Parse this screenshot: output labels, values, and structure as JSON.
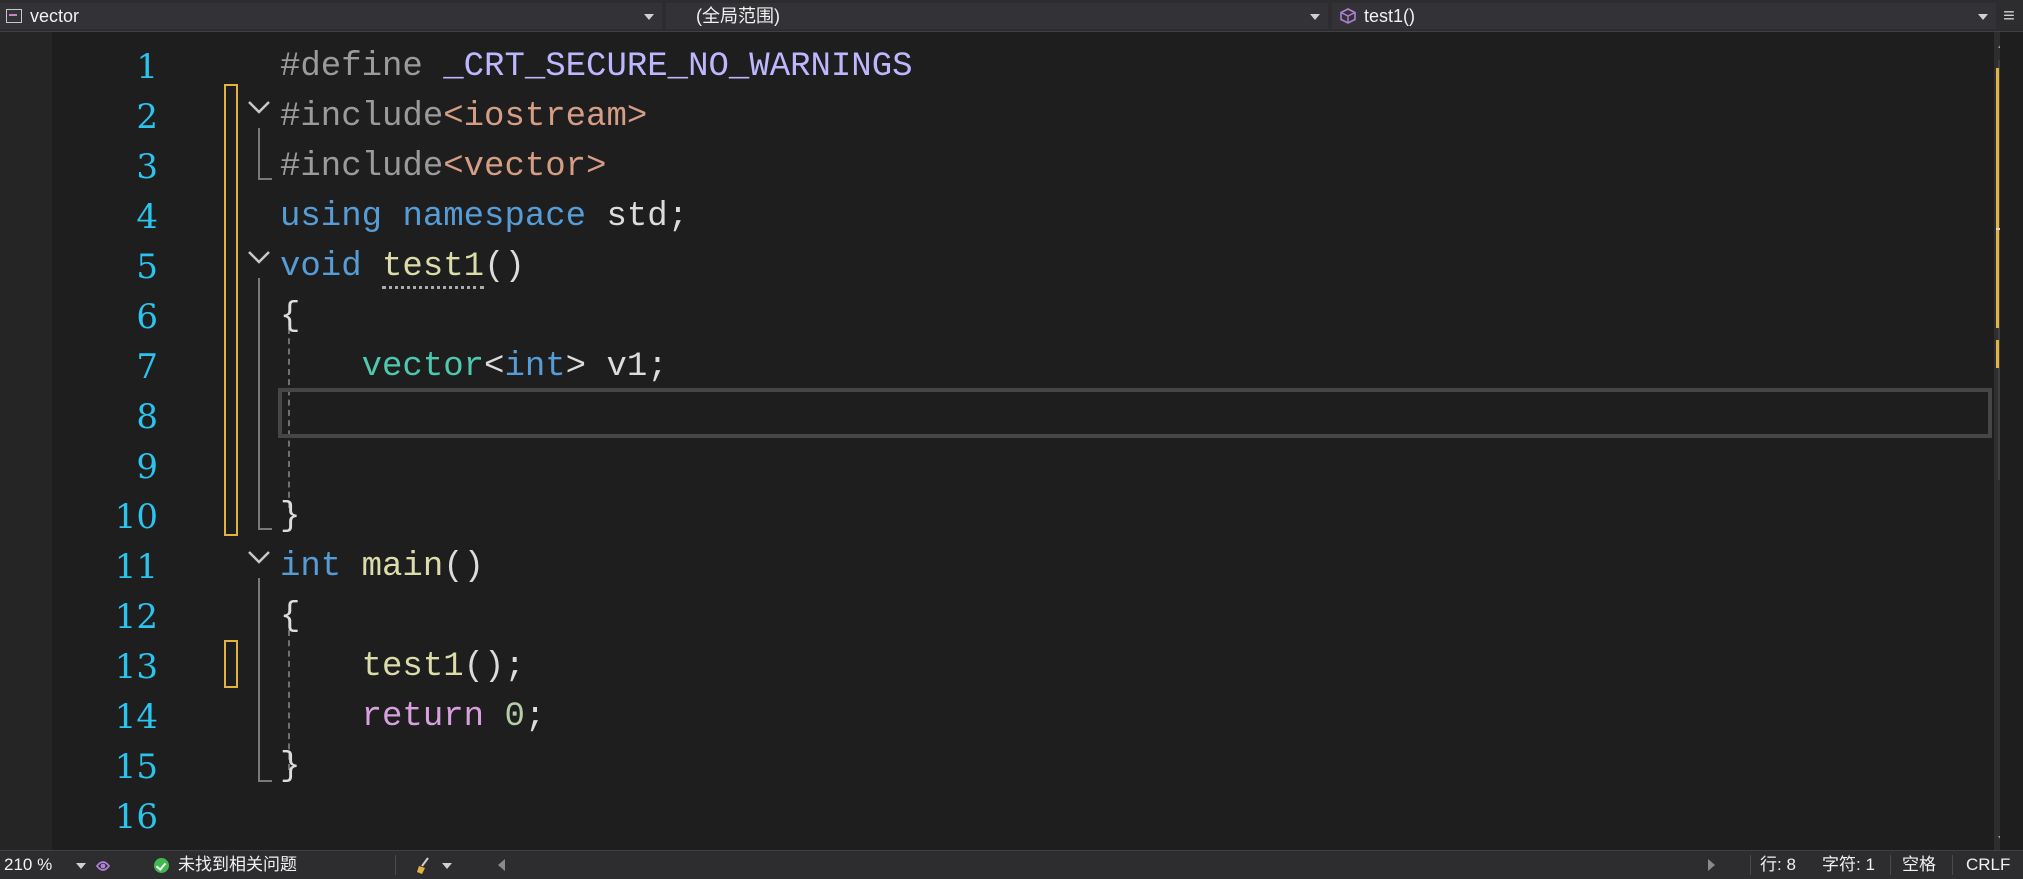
{
  "navbar": {
    "project": "vector",
    "scope": "(全局范围)",
    "member": "test1()"
  },
  "editor": {
    "lines": [
      {
        "number": "1",
        "text": "#define _CRT_SECURE_NO_WARNINGS"
      },
      {
        "number": "2",
        "text": "#include<iostream>"
      },
      {
        "number": "3",
        "text": "#include<vector>"
      },
      {
        "number": "4",
        "text": "using namespace std;"
      },
      {
        "number": "5",
        "text": "void test1()"
      },
      {
        "number": "6",
        "text": "{"
      },
      {
        "number": "7",
        "text": "    vector<int> v1;"
      },
      {
        "number": "8",
        "text": ""
      },
      {
        "number": "9",
        "text": ""
      },
      {
        "number": "10",
        "text": "}"
      },
      {
        "number": "11",
        "text": "int main()"
      },
      {
        "number": "12",
        "text": "{"
      },
      {
        "number": "13",
        "text": "    test1();"
      },
      {
        "number": "14",
        "text": "    return 0;"
      },
      {
        "number": "15",
        "text": "}"
      },
      {
        "number": "16",
        "text": ""
      }
    ],
    "current_line": 8
  },
  "statusbar": {
    "zoom": "210 %",
    "issues": "未找到相关问题",
    "line": "行: 8",
    "column": "字符: 1",
    "whitespace": "空格",
    "line_ending": "CRLF"
  },
  "colors": {
    "background": "#1e1e1e",
    "line_numbers": "#2bc4ee",
    "keyword": "#569cd6",
    "type": "#4ec9b0",
    "function": "#dcdcaa",
    "string": "#d69d85",
    "macro": "#beb7ff",
    "control": "#d8a0df",
    "number": "#b5cea8",
    "change_marker": "#e3b341"
  },
  "icons": {
    "project": "project-icon",
    "member": "method-cube-icon",
    "split": "split-window-icon",
    "issues": "check-circle-icon",
    "cleanup": "brush-icon"
  }
}
